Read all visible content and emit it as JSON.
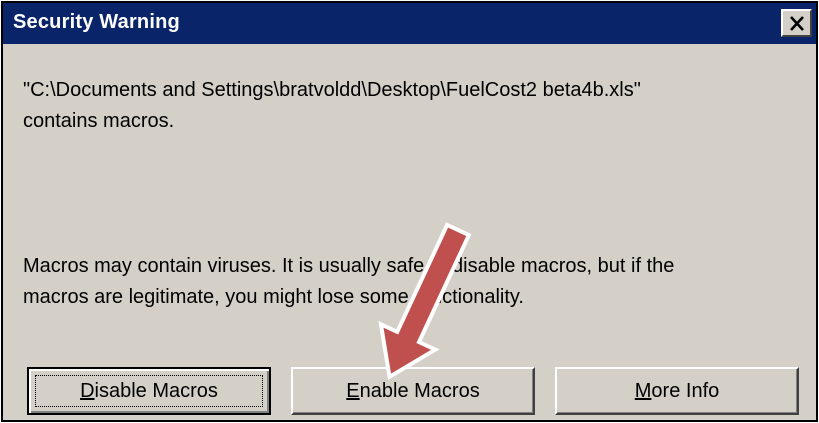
{
  "dialog": {
    "title": "Security Warning",
    "close_glyph": "X",
    "message_file_line": "\"C:\\Documents and Settings\\bratvoldd\\Desktop\\FuelCost2 beta4b.xls\"",
    "message_contains": "contains macros.",
    "message_warning_line1": "Macros may contain viruses. It is usually safe to disable macros, but if the",
    "message_warning_line2": "macros are legitimate, you might lose some functionality."
  },
  "buttons": {
    "disable": {
      "accel": "D",
      "rest": "isable Macros"
    },
    "enable": {
      "accel": "E",
      "rest": "nable Macros"
    },
    "more_info": {
      "accel": "M",
      "rest": "ore Info"
    }
  },
  "annotation": {
    "icon": "arrow-down-left-icon",
    "color": "#c0504d"
  }
}
